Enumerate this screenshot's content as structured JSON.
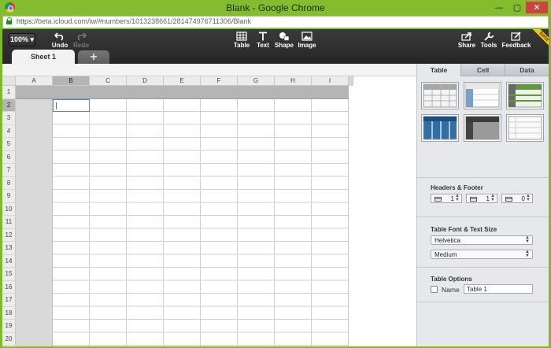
{
  "window": {
    "title": "Blank - Google Chrome",
    "url_scheme": "https://",
    "url_host": "beta.icloud.com",
    "url_path": "/iw/#numbers/1013238661/281474976711306/Blank",
    "minimize": "—",
    "maximize": "▢",
    "close": "✕"
  },
  "toolbar": {
    "zoom": "100% ▾",
    "undo": "Undo",
    "redo": "Redo",
    "table": "Table",
    "text": "Text",
    "shape": "Shape",
    "image": "Image",
    "share": "Share",
    "tools": "Tools",
    "feedback": "Feedback",
    "beta": "beta"
  },
  "sheets": {
    "active": "Sheet 1",
    "add": "+"
  },
  "grid": {
    "columns": [
      "A",
      "B",
      "C",
      "D",
      "E",
      "F",
      "G",
      "H",
      "I"
    ],
    "rows": [
      "1",
      "2",
      "3",
      "4",
      "5",
      "6",
      "7",
      "8",
      "9",
      "10",
      "11",
      "12",
      "13",
      "14",
      "15",
      "16",
      "17",
      "18",
      "19",
      "20"
    ],
    "selected_cell": "B2"
  },
  "inspector": {
    "tabs": [
      "Table",
      "Cell",
      "Data"
    ],
    "active_tab": "Table",
    "headers_footer_label": "Headers & Footer",
    "header_rows": "1",
    "header_cols": "1",
    "footer_rows": "0",
    "font_label": "Table Font & Text Size",
    "font": "Helvetica",
    "text_size": "Medium",
    "options_label": "Table Options",
    "name_label": "Name",
    "table_name": "Table 1",
    "name_checked": false
  }
}
